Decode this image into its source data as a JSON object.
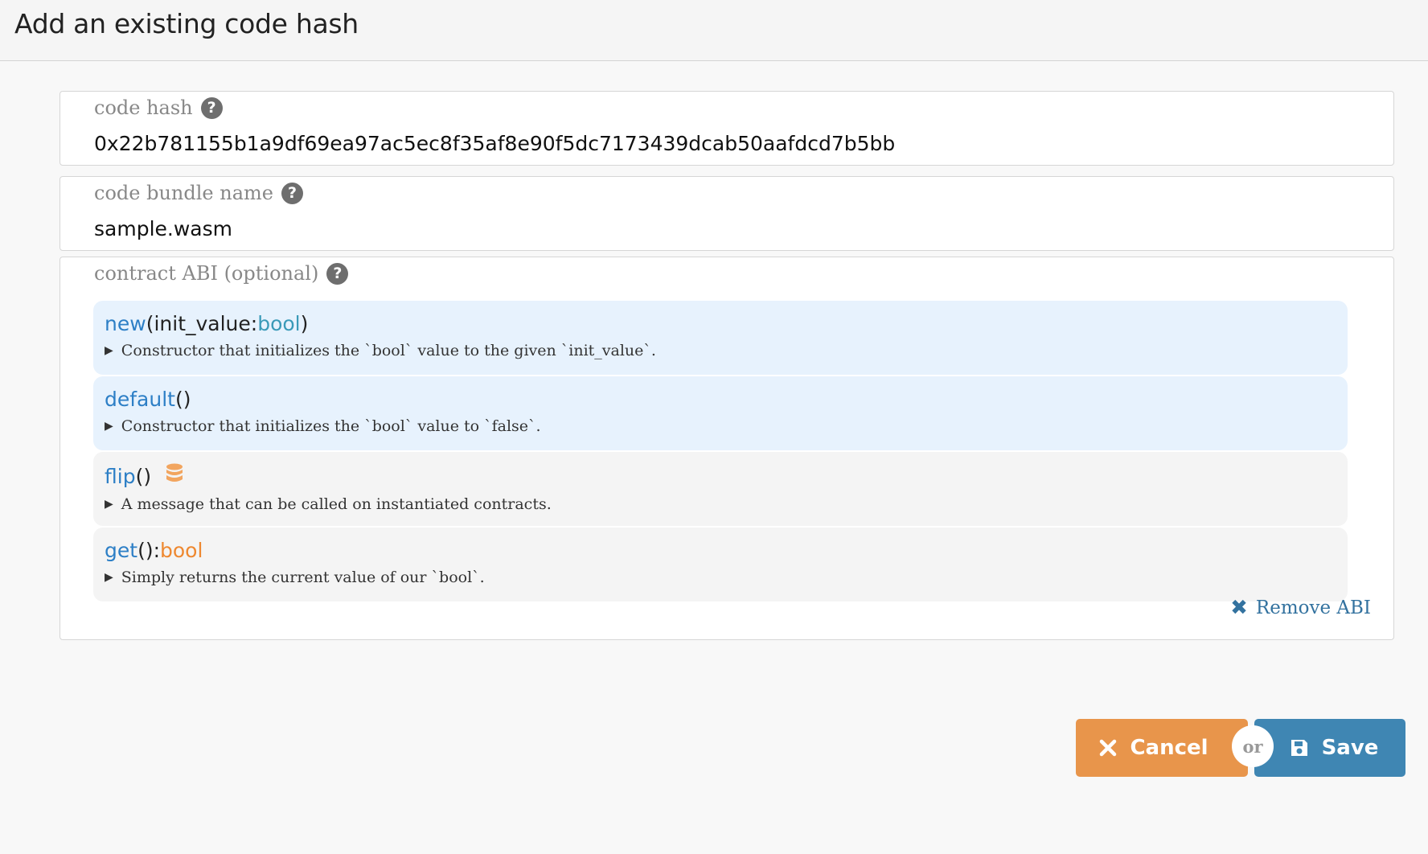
{
  "header": {
    "title": "Add an existing code hash"
  },
  "code_hash": {
    "label": "code hash",
    "value": "0x22b781155b1a9df69ea97ac5ec8f35af8e90f5dc7173439dcab50aafdcd7b5bb"
  },
  "bundle_name": {
    "label": "code bundle name",
    "value": "sample.wasm"
  },
  "abi": {
    "label": "contract ABI (optional)",
    "items": [
      {
        "name": "new",
        "open": "(",
        "param": "init_value: ",
        "param_type": "bool",
        "close": ")",
        "doc": "Constructor that initializes the `bool` value to the given `init_value`."
      },
      {
        "name": "default",
        "parens": "()",
        "doc": "Constructor that initializes the `bool` value to `false`."
      },
      {
        "name": "flip",
        "parens": "()",
        "doc": "A message that can be called on instantiated contracts."
      },
      {
        "name": "get",
        "parens": "(): ",
        "return_type": "bool",
        "doc": "Simply returns the current value of our `bool`."
      }
    ],
    "remove_label": "Remove ABI"
  },
  "actions": {
    "cancel_label": "Cancel",
    "or_label": "or",
    "save_label": "Save"
  },
  "colors": {
    "function_name": "#2d7fc6",
    "param_type": "#3a9ab8",
    "return_type": "#ee8830",
    "cancel_bg": "#e8954b",
    "save_bg": "#3f86b3",
    "constructor_bg": "#e7f2fd",
    "message_bg": "#f4f4f4"
  },
  "icons": {
    "help": "question-circle-icon",
    "storage": "database-icon",
    "remove": "close-icon",
    "cancel": "close-icon",
    "save": "floppy-disk-icon"
  }
}
